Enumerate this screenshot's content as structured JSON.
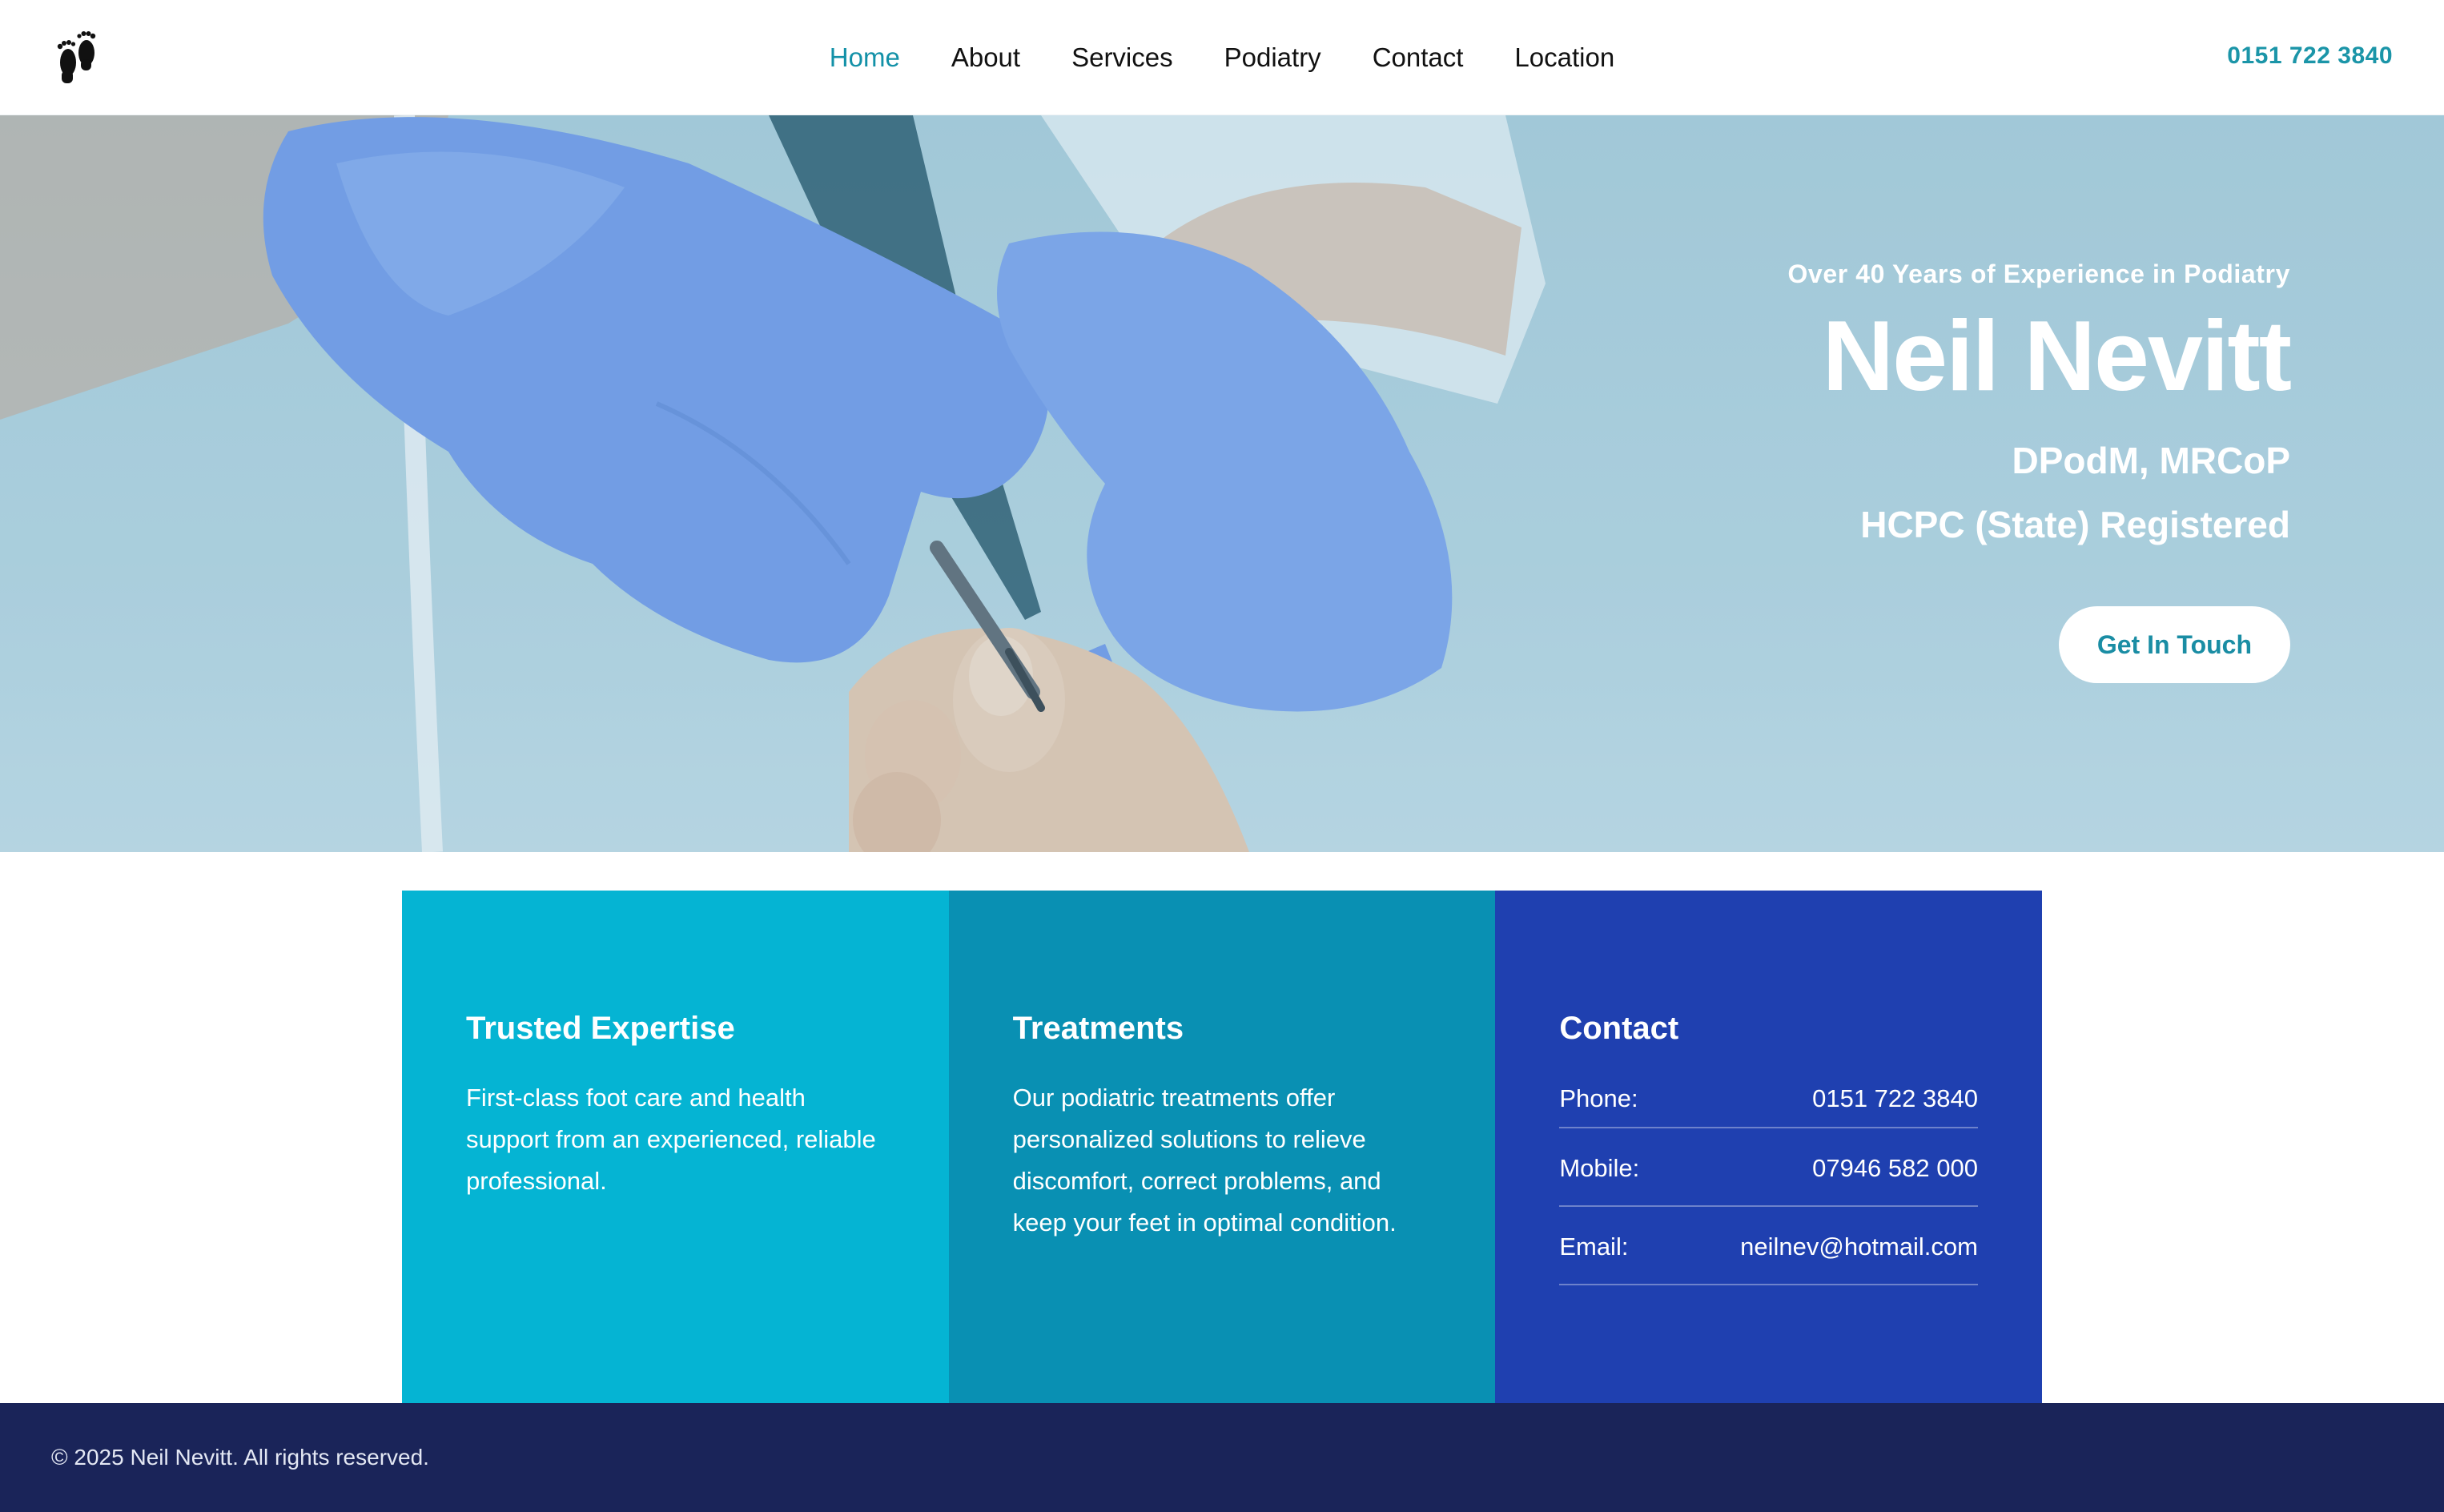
{
  "header": {
    "logo_icon": "footprints-icon",
    "nav": [
      {
        "label": "Home",
        "active": true
      },
      {
        "label": "About",
        "active": false
      },
      {
        "label": "Services",
        "active": false
      },
      {
        "label": "Podiatry",
        "active": false
      },
      {
        "label": "Contact",
        "active": false
      },
      {
        "label": "Location",
        "active": false
      }
    ],
    "phone": "0151 722 3840"
  },
  "hero": {
    "eyebrow": "Over 40 Years of Experience in Podiatry",
    "name": "Neil Nevitt",
    "credentials": "DPodM, MRCoP",
    "registration": "HCPC (State) Registered",
    "cta_label": "Get In Touch"
  },
  "cards": {
    "expertise": {
      "title": "Trusted Expertise",
      "body": "First-class foot care and health support from an experienced, reliable professional."
    },
    "treatments": {
      "title": "Treatments",
      "body": "Our podiatric treatments offer personalized solutions to relieve discomfort, correct problems, and keep your feet in optimal condition."
    },
    "contact": {
      "title": "Contact",
      "rows": [
        {
          "label": "Phone:",
          "value": "0151 722 3840"
        },
        {
          "label": "Mobile:",
          "value": "07946 582 000"
        },
        {
          "label": "Email:",
          "value": "neilnev@hotmail.com"
        }
      ]
    }
  },
  "footer": {
    "copyright": "© 2025 Neil Nevitt. All rights reserved."
  },
  "colors": {
    "accent": "#1391a8",
    "card_cyan": "#05b4d3",
    "card_teal": "#0990b3",
    "card_blue": "#1f40b0",
    "footer_navy": "#1a2459"
  }
}
